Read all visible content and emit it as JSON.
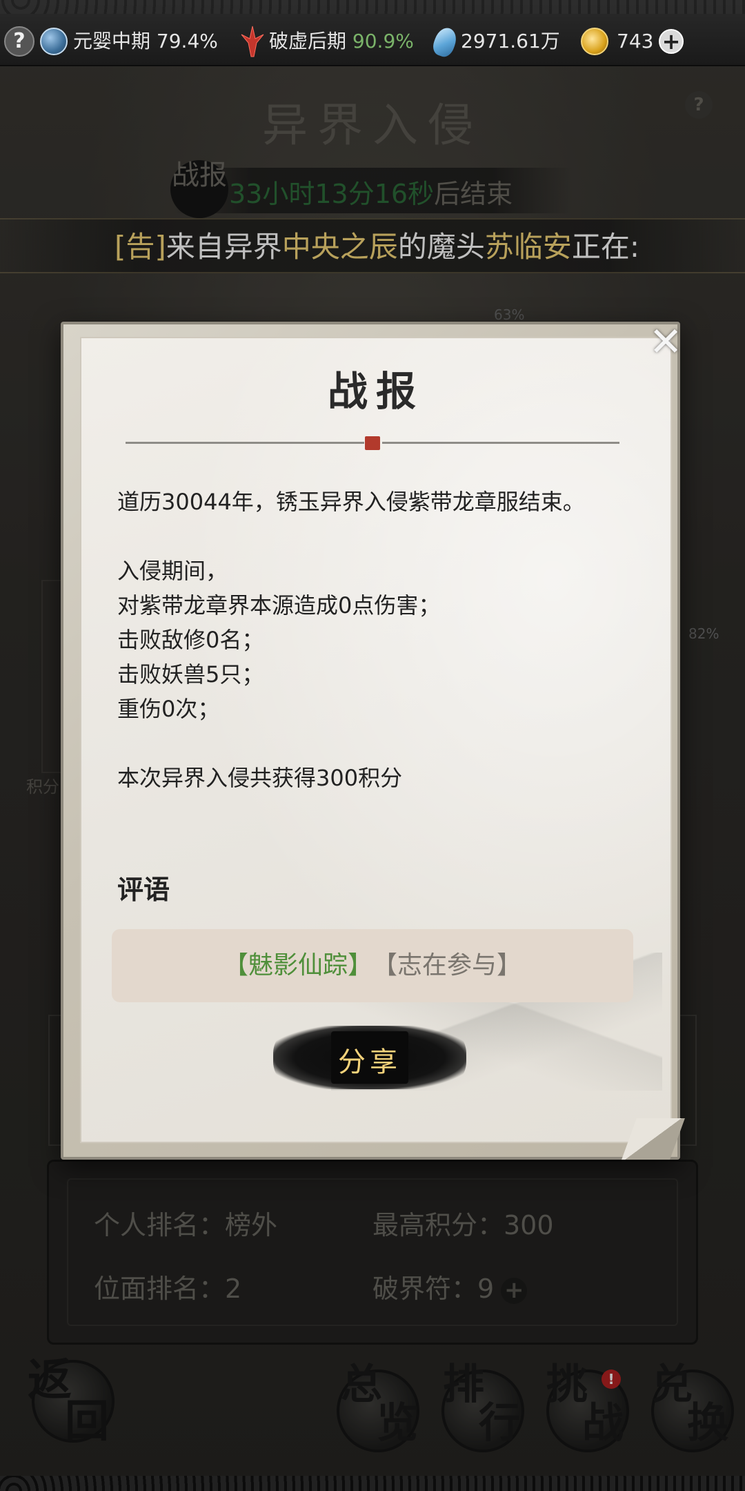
{
  "topbar": {
    "realm1_name": "元婴中期",
    "realm1_pct": "79.4%",
    "realm2_name": "破虚后期",
    "realm2_pct": "90.9%",
    "spirit_stones": "2971.61万",
    "gold": "743",
    "help": "?",
    "plus": "+"
  },
  "scene": {
    "title": "异界入侵",
    "help": "?",
    "countdown_badge": "战报",
    "countdown_time": "33小时13分16秒",
    "countdown_suffix": "后结束",
    "announcement": {
      "prefix": "[告]",
      "part1": "来自异界",
      "highlight1": "中央之辰",
      "part2": "的魔头",
      "highlight2": "苏临安",
      "part3": "正在:"
    },
    "pct_top": "63%",
    "pct_right": "82%",
    "side_label": "积分"
  },
  "modal": {
    "title": "战报",
    "close": "✕",
    "line1": "道历30044年，锈玉异界入侵紫带龙章服结束。",
    "line2": "入侵期间，",
    "line3": "对紫带龙章界本源造成0点伤害；",
    "line4": "击败敌修0名；",
    "line5": "击败妖兽5只；",
    "line6": "重伤0次；",
    "line7": "本次异界入侵共获得300积分",
    "comment_heading": "评语",
    "comment_green": "【魅影仙踪】",
    "comment_grey": "【志在参与】",
    "share": "分享"
  },
  "stats": {
    "personal_rank": "个人排名：榜外",
    "best_score": "最高积分：300",
    "plane_rank": "位面排名：2",
    "breaker_token": "破界符：9",
    "plus": "+"
  },
  "nav": {
    "back_c1": "返",
    "back_c2": "回",
    "overview_c1": "总",
    "overview_c2": "览",
    "rank_c1": "排",
    "rank_c2": "行",
    "challenge_c1": "挑",
    "challenge_c2": "战",
    "exchange_c1": "兑",
    "exchange_c2": "换",
    "challenge_badge": "!"
  },
  "colors": {
    "accent_gold": "#f6d77a",
    "green_pct": "#7ab369",
    "seal_red": "#b23a2c",
    "comment_green": "#4f8f3a"
  }
}
